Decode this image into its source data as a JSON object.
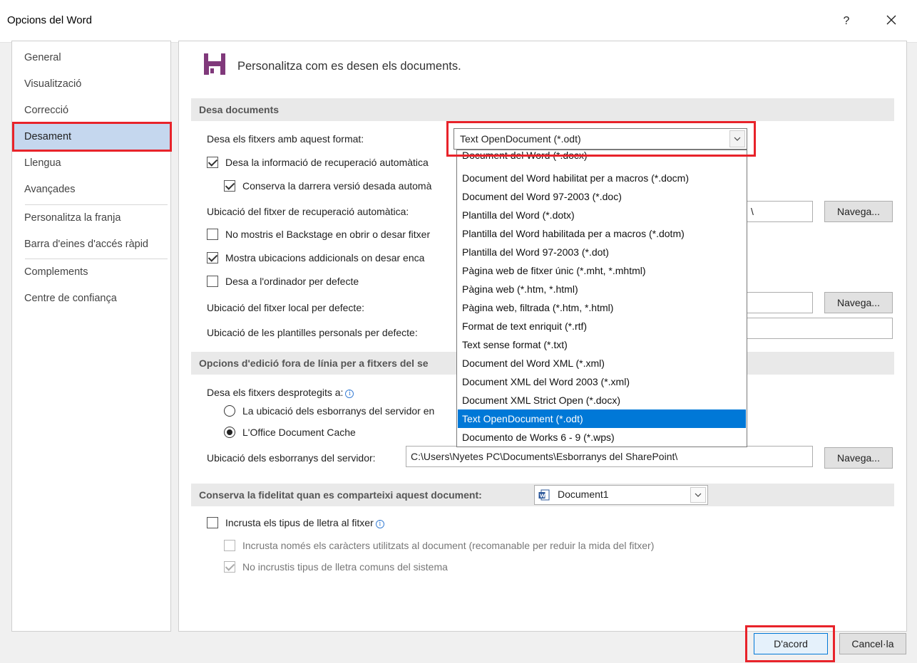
{
  "window": {
    "title": "Opcions del Word",
    "help_label": "?"
  },
  "sidebar": {
    "items": [
      {
        "label": "General"
      },
      {
        "label": "Visualització"
      },
      {
        "label": "Correcció"
      },
      {
        "label": "Desament",
        "selected": true
      },
      {
        "label": "Llengua"
      },
      {
        "label": "Avançades"
      },
      {
        "label": "Personalitza la franja"
      },
      {
        "label": "Barra d'eines d'accés ràpid"
      },
      {
        "label": "Complements"
      },
      {
        "label": "Centre de confiança"
      }
    ]
  },
  "header": {
    "icon": "floppy-disk-icon",
    "text": "Personalitza com es desen els documents."
  },
  "save_section": {
    "title": "Desa documents",
    "format_label": "Desa els fitxers amb aquest format:",
    "format_value": "Text OpenDocument (*.odt)",
    "autorecover_checkbox": {
      "label": "Desa la informació de recuperació automàtica",
      "checked": true
    },
    "keep_last_checkbox": {
      "label": "Conserva la darrera versió desada automà",
      "checked": true
    },
    "autorecover_location_label": "Ubicació del fitxer de recuperació automàtica:",
    "autorecover_location_value": "\\",
    "browse_label": "Navega...",
    "no_backstage_checkbox": {
      "label": "No mostris el Backstage en obrir o desar fitxer",
      "checked": false
    },
    "additional_locations_checkbox": {
      "label": "Mostra ubicacions addicionals on desar enca",
      "checked": true
    },
    "save_to_computer_checkbox": {
      "label": "Desa a l'ordinador per defecte",
      "checked": false
    },
    "default_local_label": "Ubicació del fitxer local per defecte:",
    "default_local_value": "",
    "templates_label": "Ubicació de les plantilles personals per defecte:",
    "templates_value": ""
  },
  "format_dropdown": {
    "options": [
      "Document del Word (*.docx)",
      "Document del Word habilitat per a macros (*.docm)",
      "Document del Word 97-2003 (*.doc)",
      "Plantilla del Word (*.dotx)",
      "Plantilla del Word habilitada per a macros (*.dotm)",
      "Plantilla del Word 97-2003 (*.dot)",
      "Pàgina web de fitxer únic (*.mht, *.mhtml)",
      "Pàgina web (*.htm, *.html)",
      "Pàgina web, filtrada (*.htm, *.html)",
      "Format de text enriquit (*.rtf)",
      "Text sense format (*.txt)",
      "Document del Word XML (*.xml)",
      "Document XML del Word 2003 (*.xml)",
      "Document XML Strict Open (*.docx)",
      "Text OpenDocument (*.odt)",
      "Documento de Works 6 - 9 (*.wps)"
    ],
    "selected_index": 14
  },
  "offline_section": {
    "title": "Opcions d'edició fora de línia per a fitxers del se",
    "save_checked_out_label": "Desa els fitxers desprotegits a:",
    "radio_server": {
      "label": "La ubicació dels esborranys del servidor en",
      "selected": false
    },
    "radio_cache": {
      "label": "L'Office Document Cache",
      "selected": true
    },
    "server_drafts_label": "Ubicació dels esborranys del servidor:",
    "server_drafts_value": "C:\\Users\\Nyetes PC\\Documents\\Esborranys del SharePoint\\",
    "browse_label": "Navega..."
  },
  "fidelity_section": {
    "title": "Conserva la fidelitat quan es comparteixi aquest document:",
    "doc_value": "Document1",
    "embed_fonts": {
      "label": "Incrusta els tipus de lletra al fitxer",
      "checked": false
    },
    "embed_used_chars": {
      "label": "Incrusta només els caràcters utilitzats al document (recomanable per reduir la mida del fitxer)",
      "checked": false
    },
    "no_common_fonts": {
      "label": "No incrustis tipus de lletra comuns del sistema",
      "checked": true
    }
  },
  "footer": {
    "ok_label": "D'acord",
    "cancel_label": "Cancel·la"
  },
  "colors": {
    "highlight_red": "#e8232a",
    "selection_blue": "#0078d7",
    "nav_selected": "#c5d7ee",
    "floppy_purple": "#80397b"
  }
}
